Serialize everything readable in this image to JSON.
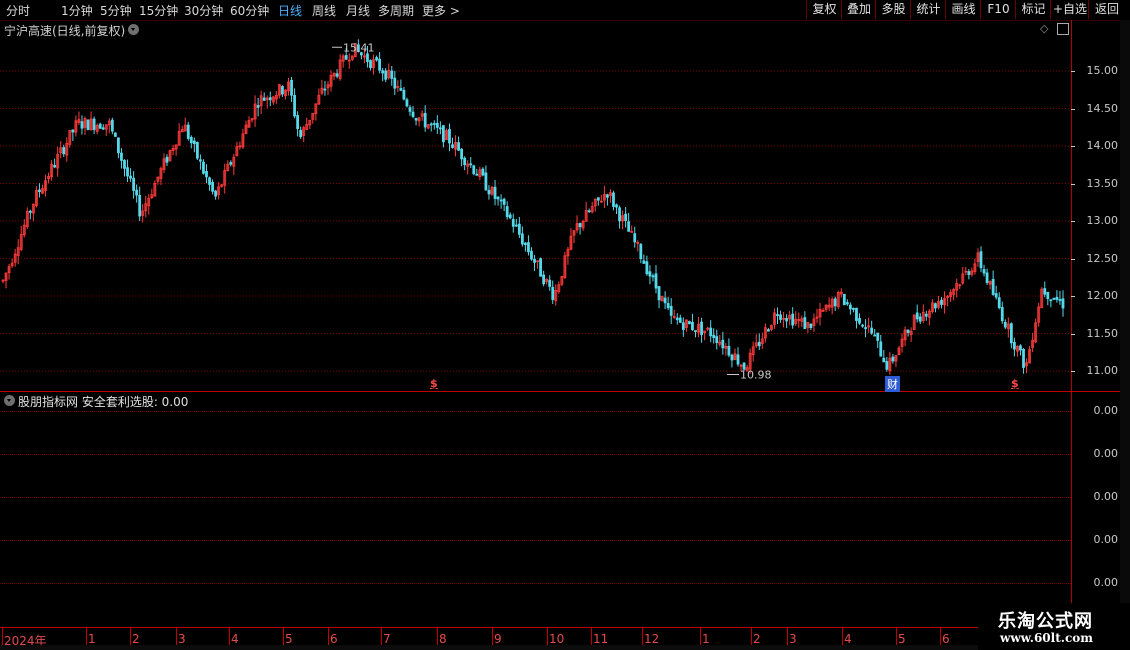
{
  "toolbar": {
    "periods": [
      {
        "label": "分时",
        "active": false
      },
      {
        "label": "1分钟",
        "active": false
      },
      {
        "label": "5分钟",
        "active": false
      },
      {
        "label": "15分钟",
        "active": false
      },
      {
        "label": "30分钟",
        "active": false
      },
      {
        "label": "60分钟",
        "active": false
      },
      {
        "label": "日线",
        "active": true
      },
      {
        "label": "周线",
        "active": false
      },
      {
        "label": "月线",
        "active": false
      },
      {
        "label": "多周期",
        "active": false
      },
      {
        "label": "更多 >",
        "active": false
      }
    ],
    "buttons": [
      "复权",
      "叠加",
      "多股",
      "统计",
      "画线",
      "F10",
      "标记",
      "+自选",
      "返回"
    ]
  },
  "main_pane": {
    "title": "宁沪高速(日线,前复权)",
    "y_ticks": [
      "15.00",
      "14.50",
      "14.00",
      "13.50",
      "13.00",
      "12.50",
      "12.00",
      "11.50",
      "11.00"
    ],
    "high_label": "15.41",
    "low_label": "10.98",
    "markers": [
      {
        "type": "dollar",
        "text": "$"
      },
      {
        "type": "fin",
        "text": "财"
      },
      {
        "type": "dollar",
        "text": "$"
      }
    ]
  },
  "indicator_pane": {
    "title": "股朋指标网 安全套利选股: 0.00",
    "y_ticks": [
      "0.00",
      "0.00",
      "0.00",
      "0.00",
      "0.00"
    ]
  },
  "x_axis": {
    "labels": [
      "2024年",
      "1",
      "2",
      "3",
      "4",
      "5",
      "6",
      "7",
      "8",
      "9",
      "10",
      "11",
      "12",
      "1",
      "2",
      "3",
      "4",
      "5",
      "6"
    ]
  },
  "watermark": {
    "line1": "乐淘公式网",
    "line2": "www.60lt.com"
  },
  "colors": {
    "up": "#ff3b3b",
    "down": "#54d8ea",
    "grid": "#7a0000",
    "axis": "#c8c8c8",
    "active_period": "#4ab0ff"
  },
  "chart_data": {
    "type": "candlestick",
    "symbol": "宁沪高速",
    "y_range": [
      10.98,
      15.41
    ],
    "anchors": [
      {
        "t": 0.0,
        "price": 12.2
      },
      {
        "t": 0.03,
        "price": 13.3
      },
      {
        "t": 0.07,
        "price": 14.3
      },
      {
        "t": 0.1,
        "price": 14.3
      },
      {
        "t": 0.13,
        "price": 13.1
      },
      {
        "t": 0.16,
        "price": 14.0
      },
      {
        "t": 0.17,
        "price": 14.3
      },
      {
        "t": 0.2,
        "price": 13.3
      },
      {
        "t": 0.24,
        "price": 14.6
      },
      {
        "t": 0.27,
        "price": 14.8
      },
      {
        "t": 0.28,
        "price": 14.1
      },
      {
        "t": 0.3,
        "price": 14.7
      },
      {
        "t": 0.33,
        "price": 15.3
      },
      {
        "t": 0.36,
        "price": 15.0
      },
      {
        "t": 0.39,
        "price": 14.4
      },
      {
        "t": 0.42,
        "price": 14.1
      },
      {
        "t": 0.45,
        "price": 13.6
      },
      {
        "t": 0.48,
        "price": 13.0
      },
      {
        "t": 0.52,
        "price": 12.0
      },
      {
        "t": 0.54,
        "price": 12.9
      },
      {
        "t": 0.57,
        "price": 13.4
      },
      {
        "t": 0.6,
        "price": 12.6
      },
      {
        "t": 0.63,
        "price": 11.7
      },
      {
        "t": 0.67,
        "price": 11.5
      },
      {
        "t": 0.7,
        "price": 11.05
      },
      {
        "t": 0.73,
        "price": 11.8
      },
      {
        "t": 0.76,
        "price": 11.6
      },
      {
        "t": 0.79,
        "price": 12.0
      },
      {
        "t": 0.82,
        "price": 11.5
      },
      {
        "t": 0.835,
        "price": 11.05
      },
      {
        "t": 0.86,
        "price": 11.7
      },
      {
        "t": 0.89,
        "price": 12.0
      },
      {
        "t": 0.92,
        "price": 12.5
      },
      {
        "t": 0.95,
        "price": 11.5
      },
      {
        "t": 0.965,
        "price": 11.05
      },
      {
        "t": 0.98,
        "price": 12.1
      },
      {
        "t": 1.0,
        "price": 11.9
      }
    ]
  }
}
